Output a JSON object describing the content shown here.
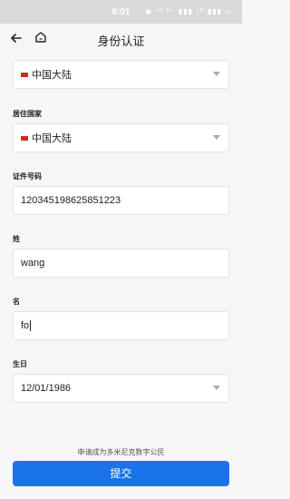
{
  "status_bar": {
    "time": "6:01",
    "icons_text": "◉ ⁴ᴳ ᴴ⁺ ▮▮▮ ⁴ᴳ ▮▮▮ ▭"
  },
  "header": {
    "title": "身份认证",
    "back_icon": "arrow-left",
    "home_icon": "home"
  },
  "form": {
    "nationality": {
      "value": "中国大陆"
    },
    "residence_country": {
      "label": "居住国家",
      "value": "中国大陆"
    },
    "id_number": {
      "label": "证件号码",
      "value": "120345198625851223"
    },
    "last_name": {
      "label": "姓",
      "value": "wang"
    },
    "first_name": {
      "label": "名",
      "value": "fo"
    },
    "birthday": {
      "label": "生日",
      "value": "12/01/1986"
    }
  },
  "footer": {
    "apply_text": "申请成为多米尼克数字公民",
    "submit_label": "提交"
  },
  "colors": {
    "accent": "#1a73e8",
    "flag": "#d9281e"
  }
}
